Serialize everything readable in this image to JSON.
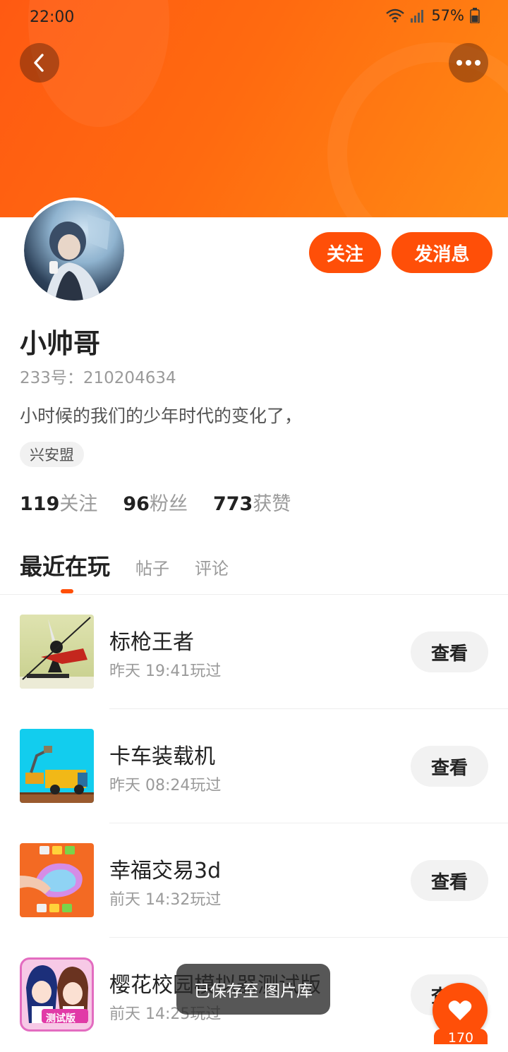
{
  "status_bar": {
    "time": "22:00",
    "battery": "57%"
  },
  "profile": {
    "name": "小帅哥",
    "uid": "233号：210204634",
    "bio": "小时候的我们的少年时代的变化了，",
    "tag": "兴安盟",
    "follow_label": "关注",
    "message_label": "发消息"
  },
  "stats": [
    {
      "count": "119",
      "label": "关注"
    },
    {
      "count": "96",
      "label": "粉丝"
    },
    {
      "count": "773",
      "label": "获赞"
    }
  ],
  "tabs": [
    {
      "label": "最近在玩",
      "active": true
    },
    {
      "label": "帖子",
      "active": false
    },
    {
      "label": "评论",
      "active": false
    }
  ],
  "games": [
    {
      "title": "标枪王者",
      "time": "昨天 19:41玩过",
      "action": "查看"
    },
    {
      "title": "卡车装载机",
      "time": "昨天 08:24玩过",
      "action": "查看"
    },
    {
      "title": "幸福交易3d",
      "time": "前天 14:32玩过",
      "action": "查看"
    },
    {
      "title": "樱花校园模拟器测试版",
      "time": "前天 14:25玩过",
      "action": "查看",
      "thumb_text": "测试版"
    }
  ],
  "toast": "已保存至 图片库",
  "like": {
    "count": "170"
  },
  "colors": {
    "accent": "#ff4f08",
    "header_start": "#ff5a12",
    "header_end": "#ff8a14"
  }
}
